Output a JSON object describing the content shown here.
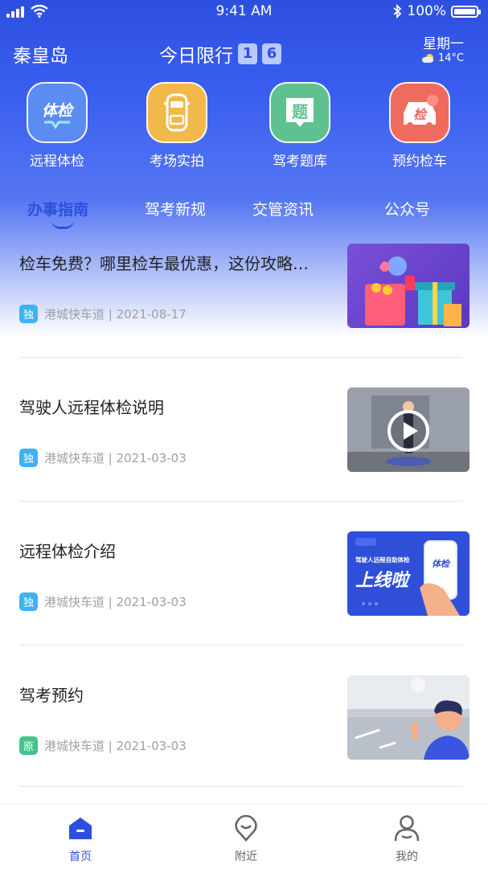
{
  "status_bar": {
    "time": "9:41 AM",
    "battery": "100%"
  },
  "header": {
    "city": "秦皇岛",
    "limit_label": "今日限行",
    "limit_digits": [
      "1",
      "6"
    ],
    "weekday": "星期一",
    "temperature": "14°C"
  },
  "quick_actions": [
    {
      "label": "远程体检",
      "icon": "health-check-icon",
      "color": "#5a8cf2",
      "glyph": "体检"
    },
    {
      "label": "考场实拍",
      "icon": "car-topview-icon",
      "color": "#f1b84a",
      "glyph": ""
    },
    {
      "label": "驾考题库",
      "icon": "question-bank-icon",
      "color": "#5fc18f",
      "glyph": "题"
    },
    {
      "label": "预约检车",
      "icon": "inspection-car-icon",
      "color": "#ef6b5e",
      "glyph": "检"
    }
  ],
  "tabs": [
    {
      "label": "办事指南",
      "active": true
    },
    {
      "label": "驾考新规",
      "active": false
    },
    {
      "label": "交管资讯",
      "active": false
    },
    {
      "label": "公众号",
      "active": false
    }
  ],
  "articles": [
    {
      "title": "检车免费？哪里检车最优惠，这份攻略…",
      "badge": "独",
      "badge_color": "#3db3f0",
      "source": "港城快车道 | 2021-08-17",
      "thumb": "gift-boxes-thumbnail"
    },
    {
      "title": "驾驶人远程体检说明",
      "badge": "独",
      "badge_color": "#3db3f0",
      "source": "港城快车道 | 2021-03-03",
      "thumb": "video-thumbnail"
    },
    {
      "title": "远程体检介绍",
      "badge": "独",
      "badge_color": "#3db3f0",
      "source": "港城快车道 | 2021-03-03",
      "thumb": "online-launch-thumbnail"
    },
    {
      "title": "驾考预约",
      "badge": "原",
      "badge_color": "#44c38a",
      "source": "港城快车道 | 2021-03-03",
      "thumb": "person-road-thumbnail"
    }
  ],
  "thumb_texts": {
    "launch_small": "驾驶人远程自助体检",
    "launch_big": "上线啦",
    "phone_label": "体检"
  },
  "tabbar": [
    {
      "label": "首页",
      "active": true,
      "icon": "home-icon"
    },
    {
      "label": "附近",
      "active": false,
      "icon": "location-icon"
    },
    {
      "label": "我的",
      "active": false,
      "icon": "profile-icon"
    }
  ],
  "colors": {
    "primary": "#2d4fe0",
    "text": "#222222",
    "meta": "#a0a0a0"
  }
}
